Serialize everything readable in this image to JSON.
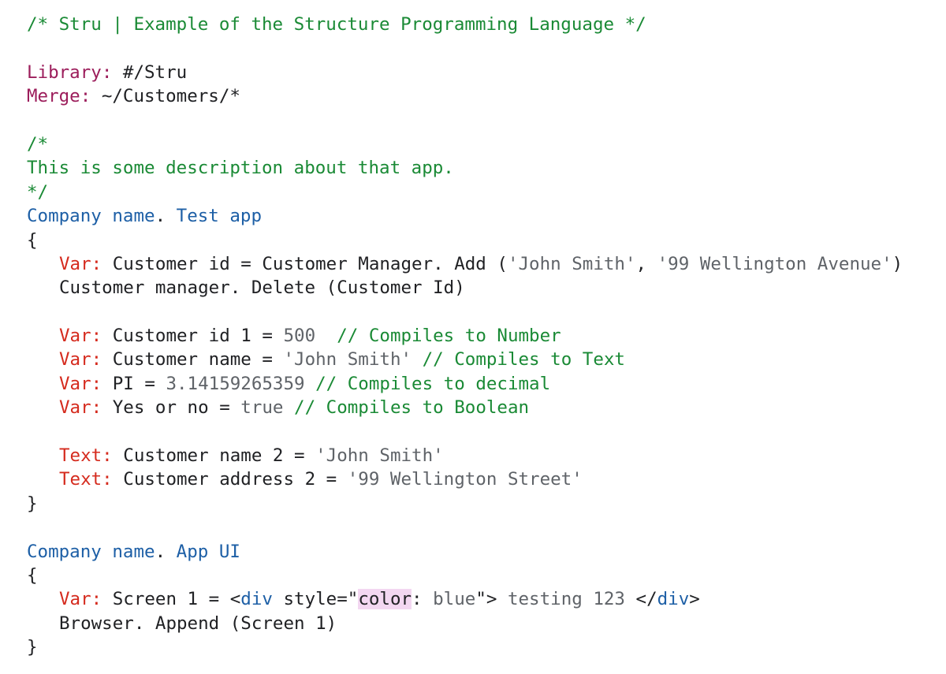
{
  "lines": [
    {
      "indent": false,
      "tokens": [
        {
          "t": "comment",
          "text": "/* Stru | Example of the Structure Programming Language */"
        }
      ]
    },
    {
      "indent": false,
      "tokens": []
    },
    {
      "indent": false,
      "tokens": [
        {
          "t": "directive",
          "text": "Library:"
        },
        {
          "t": "plain",
          "text": " #/Stru"
        }
      ]
    },
    {
      "indent": false,
      "tokens": [
        {
          "t": "directive",
          "text": "Merge:"
        },
        {
          "t": "plain",
          "text": " ~/Customers/*"
        }
      ]
    },
    {
      "indent": false,
      "tokens": []
    },
    {
      "indent": false,
      "tokens": [
        {
          "t": "comment",
          "text": "/*"
        }
      ]
    },
    {
      "indent": false,
      "tokens": [
        {
          "t": "comment",
          "text": "This is some description about that app."
        }
      ]
    },
    {
      "indent": false,
      "tokens": [
        {
          "t": "comment",
          "text": "*/"
        }
      ]
    },
    {
      "indent": false,
      "tokens": [
        {
          "t": "type",
          "text": "Company name"
        },
        {
          "t": "plain",
          "text": ". "
        },
        {
          "t": "type",
          "text": "Test app"
        }
      ]
    },
    {
      "indent": false,
      "tokens": [
        {
          "t": "plain",
          "text": "{"
        }
      ]
    },
    {
      "indent": true,
      "tokens": [
        {
          "t": "keyword",
          "text": "Var:"
        },
        {
          "t": "plain",
          "text": " Customer id = Customer Manager. Add ("
        },
        {
          "t": "string",
          "text": "'John Smith'"
        },
        {
          "t": "plain",
          "text": ", "
        },
        {
          "t": "string",
          "text": "'99 Wellington Avenue'"
        },
        {
          "t": "plain",
          "text": ")"
        }
      ]
    },
    {
      "indent": true,
      "tokens": [
        {
          "t": "plain",
          "text": "Customer manager. Delete (Customer Id)"
        }
      ]
    },
    {
      "indent": true,
      "tokens": []
    },
    {
      "indent": true,
      "tokens": [
        {
          "t": "keyword",
          "text": "Var:"
        },
        {
          "t": "plain",
          "text": " Customer id 1 = "
        },
        {
          "t": "number",
          "text": "500"
        },
        {
          "t": "plain",
          "text": "  "
        },
        {
          "t": "comment",
          "text": "// Compiles to Number"
        }
      ]
    },
    {
      "indent": true,
      "tokens": [
        {
          "t": "keyword",
          "text": "Var:"
        },
        {
          "t": "plain",
          "text": " Customer name = "
        },
        {
          "t": "string",
          "text": "'John Smith'"
        },
        {
          "t": "plain",
          "text": " "
        },
        {
          "t": "comment",
          "text": "// Compiles to Text"
        }
      ]
    },
    {
      "indent": true,
      "tokens": [
        {
          "t": "keyword",
          "text": "Var:"
        },
        {
          "t": "plain",
          "text": " PI = "
        },
        {
          "t": "number",
          "text": "3.14159265359"
        },
        {
          "t": "plain",
          "text": " "
        },
        {
          "t": "comment",
          "text": "// Compiles to decimal"
        }
      ]
    },
    {
      "indent": true,
      "tokens": [
        {
          "t": "keyword",
          "text": "Var:"
        },
        {
          "t": "plain",
          "text": " Yes or no = "
        },
        {
          "t": "number",
          "text": "true"
        },
        {
          "t": "plain",
          "text": " "
        },
        {
          "t": "comment",
          "text": "// Compiles to Boolean"
        }
      ]
    },
    {
      "indent": true,
      "tokens": []
    },
    {
      "indent": true,
      "tokens": [
        {
          "t": "keyword",
          "text": "Text:"
        },
        {
          "t": "plain",
          "text": " Customer name 2 = "
        },
        {
          "t": "string",
          "text": "'John Smith'"
        }
      ]
    },
    {
      "indent": true,
      "tokens": [
        {
          "t": "keyword",
          "text": "Text:"
        },
        {
          "t": "plain",
          "text": " Customer address 2 = "
        },
        {
          "t": "string",
          "text": "'99 Wellington Street'"
        }
      ]
    },
    {
      "indent": false,
      "tokens": [
        {
          "t": "plain",
          "text": "}"
        }
      ]
    },
    {
      "indent": false,
      "tokens": []
    },
    {
      "indent": false,
      "tokens": [
        {
          "t": "type",
          "text": "Company name"
        },
        {
          "t": "plain",
          "text": ". "
        },
        {
          "t": "type",
          "text": "App UI"
        }
      ]
    },
    {
      "indent": false,
      "tokens": [
        {
          "t": "plain",
          "text": "{"
        }
      ]
    },
    {
      "indent": true,
      "tokens": [
        {
          "t": "keyword",
          "text": "Var:"
        },
        {
          "t": "plain",
          "text": " Screen 1 = <"
        },
        {
          "t": "tag",
          "text": "div"
        },
        {
          "t": "plain",
          "text": " style=\""
        },
        {
          "t": "highlight",
          "text": "color"
        },
        {
          "t": "plain",
          "text": ": "
        },
        {
          "t": "string",
          "text": "blue"
        },
        {
          "t": "plain",
          "text": "\">"
        },
        {
          "t": "string",
          "text": " testing 123 "
        },
        {
          "t": "plain",
          "text": "</"
        },
        {
          "t": "tag",
          "text": "div"
        },
        {
          "t": "plain",
          "text": ">"
        }
      ]
    },
    {
      "indent": true,
      "tokens": [
        {
          "t": "plain",
          "text": "Browser. Append (Screen 1)"
        }
      ]
    },
    {
      "indent": false,
      "tokens": [
        {
          "t": "plain",
          "text": "}"
        }
      ]
    }
  ],
  "colors": {
    "background": "#ffffff",
    "comment": "#1a8a35",
    "directive": "#9c1d5b",
    "plain": "#202124",
    "type": "#1d5fa6",
    "keyword": "#d52b1e",
    "string": "#5f6368",
    "number": "#5f6368",
    "tag": "#1d5fa6",
    "highlight_bg": "#f3d7f1"
  }
}
